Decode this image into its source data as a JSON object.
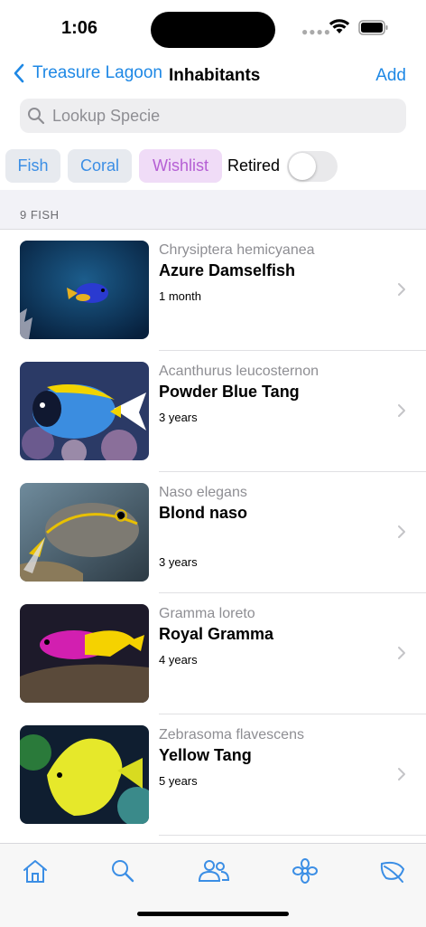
{
  "status_bar": {
    "time": "1:06",
    "signal_icon": "signal-dots-icon",
    "wifi_icon": "wifi-icon",
    "battery_icon": "battery-icon"
  },
  "nav": {
    "back_label": "Treasure Lagoon",
    "title": "Inhabitants",
    "add_label": "Add"
  },
  "search": {
    "placeholder": "Lookup Specie"
  },
  "filters": {
    "fish": "Fish",
    "coral": "Coral",
    "wishlist": "Wishlist",
    "retired_label": "Retired",
    "retired_on": false
  },
  "section": {
    "header": "9 FISH"
  },
  "items": [
    {
      "scientific": "Chrysiptera hemicyanea",
      "name": "Azure Damselfish",
      "age": "1 month"
    },
    {
      "scientific": "Acanthurus leucosternon",
      "name": "Powder Blue Tang",
      "age": "3 years"
    },
    {
      "scientific": "Naso elegans",
      "name": "Blond naso",
      "age": "3 years"
    },
    {
      "scientific": "Gramma loreto",
      "name": "Royal Gramma",
      "age": "4 years"
    },
    {
      "scientific": "Zebrasoma flavescens",
      "name": "Yellow Tang",
      "age": "5 years"
    }
  ],
  "tabs": [
    "home-icon",
    "search-icon",
    "people-icon",
    "coral-icon",
    "leaf-icon"
  ],
  "colors": {
    "accent": "#1e88e5",
    "wishlist": "#b55fd4",
    "secondary_text": "#8e8e93"
  }
}
